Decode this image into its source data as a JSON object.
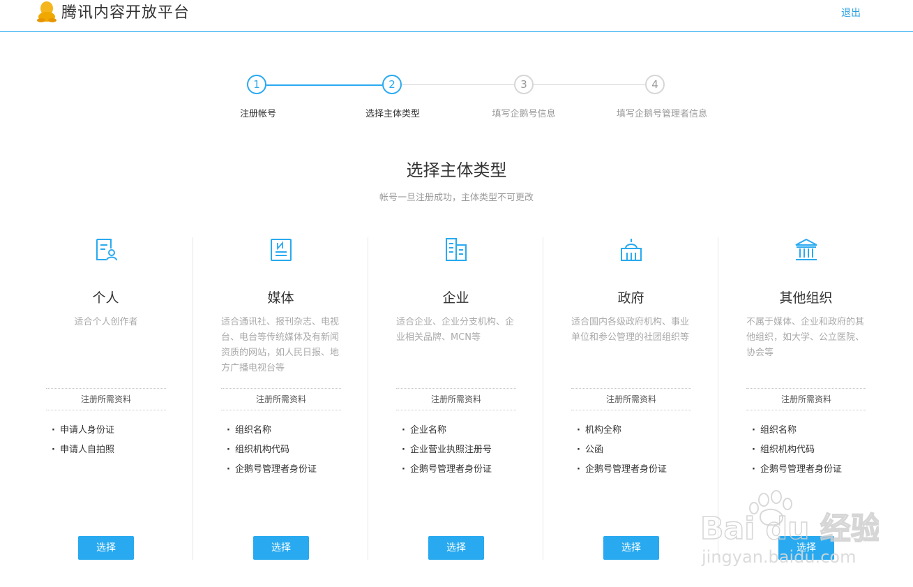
{
  "header": {
    "logo_text": "腾讯内容开放平台",
    "logo_icon": "penguin-icon",
    "logout_label": "退出"
  },
  "steps": [
    {
      "number": "1",
      "label": "注册帐号",
      "state": "done"
    },
    {
      "number": "2",
      "label": "选择主体类型",
      "state": "active"
    },
    {
      "number": "3",
      "label": "填写企鹅号信息",
      "state": "todo"
    },
    {
      "number": "4",
      "label": "填写企鹅号管理者信息",
      "state": "todo"
    }
  ],
  "main": {
    "title": "选择主体类型",
    "subtitle": "帐号一旦注册成功，主体类型不可更改"
  },
  "cards": [
    {
      "icon": "person-document-icon",
      "title": "个人",
      "desc": "适合个人创作者",
      "req_title": "注册所需资料",
      "requirements": [
        "申请人身份证",
        "申请人自拍照"
      ],
      "button": "选择"
    },
    {
      "icon": "newspaper-icon",
      "title": "媒体",
      "desc": "适合通讯社、报刊杂志、电视台、电台等传统媒体及有新闻资质的网站，如人民日报、地方广播电视台等",
      "req_title": "注册所需资料",
      "requirements": [
        "组织名称",
        "组织机构代码",
        "企鹅号管理者身份证"
      ],
      "button": "选择"
    },
    {
      "icon": "office-building-icon",
      "title": "企业",
      "desc": "适合企业、企业分支机构、企业相关品牌、MCN等",
      "req_title": "注册所需资料",
      "requirements": [
        "企业名称",
        "企业营业执照注册号",
        "企鹅号管理者身份证"
      ],
      "button": "选择"
    },
    {
      "icon": "government-building-icon",
      "title": "政府",
      "desc": "适合国内各级政府机构、事业单位和参公管理的社团组织等",
      "req_title": "注册所需资料",
      "requirements": [
        "机构全称",
        "公函",
        "企鹅号管理者身份证"
      ],
      "button": "选择"
    },
    {
      "icon": "institution-icon",
      "title": "其他组织",
      "desc": "不属于媒体、企业和政府的其他组织，如大学、公立医院、协会等",
      "req_title": "注册所需资料",
      "requirements": [
        "组织名称",
        "组织机构代码",
        "企鹅号管理者身份证"
      ],
      "button": "选择"
    }
  ],
  "watermark": {
    "text_main": "Bai du 经验",
    "text_url": "jingyan.baidu.com"
  },
  "colors": {
    "accent": "#29aaf0",
    "muted_text": "#999999",
    "desc_text": "#aaaaaa"
  }
}
